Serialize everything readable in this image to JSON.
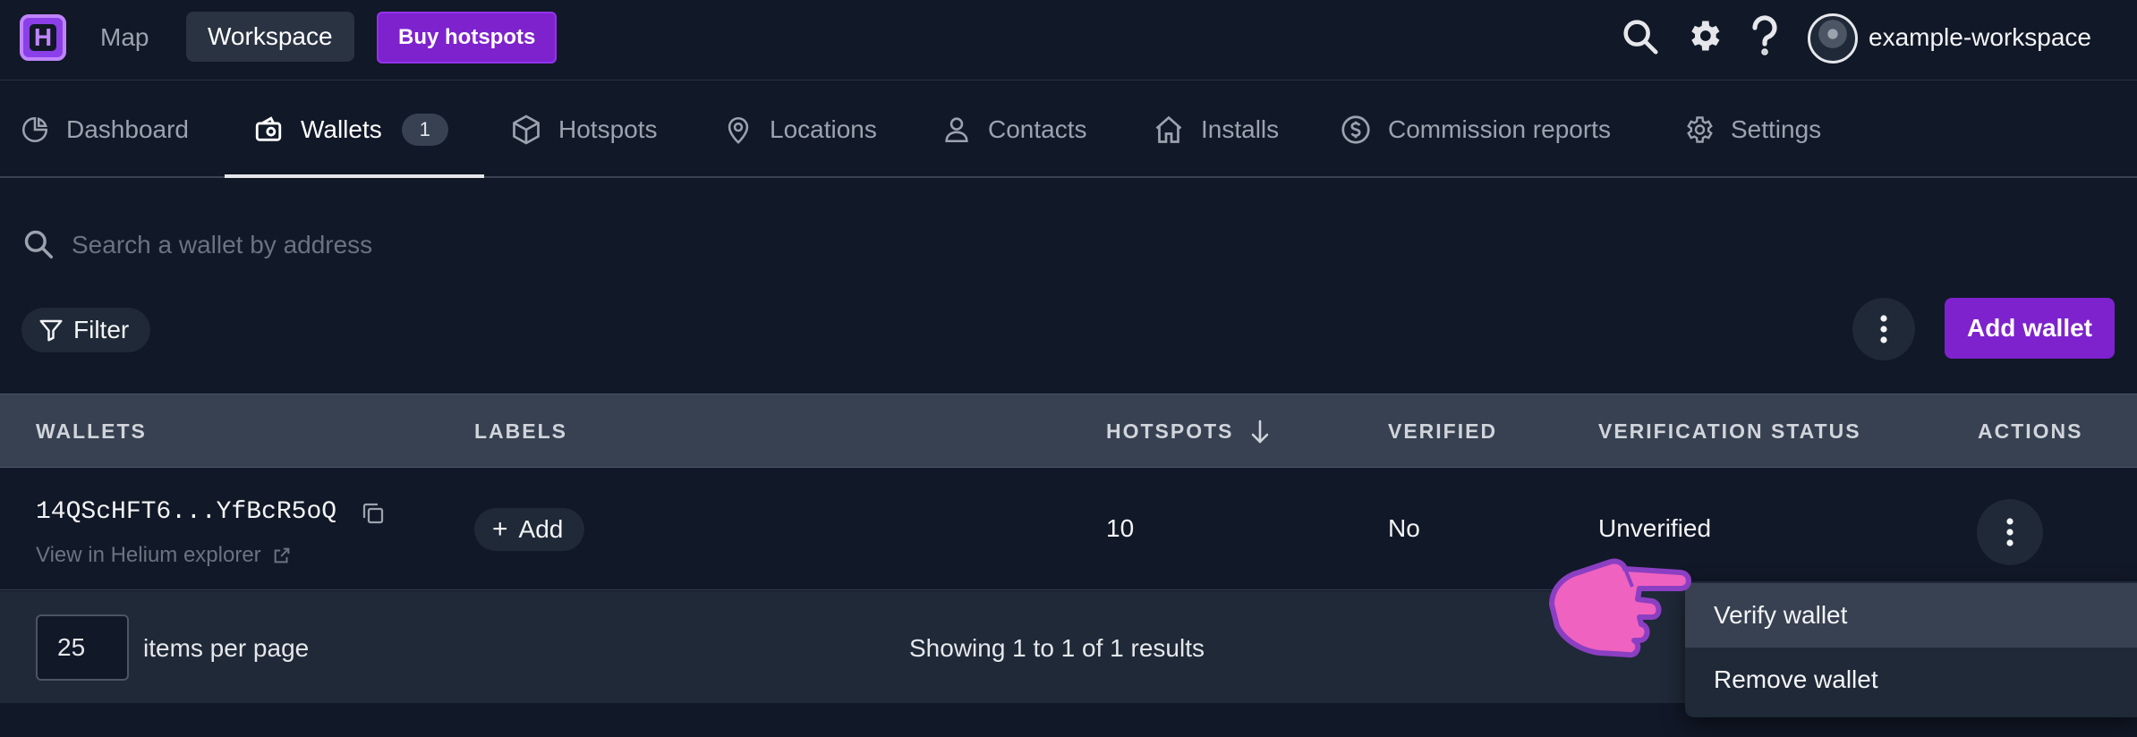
{
  "topbar": {
    "logo_letter": "H",
    "map_label": "Map",
    "workspace_label": "Workspace",
    "buy_label": "Buy hotspots",
    "workspace_name": "example-workspace",
    "icons": [
      "search-icon",
      "gear-icon",
      "help-icon"
    ]
  },
  "tabs": [
    {
      "label": "Dashboard",
      "icon": "pie-chart-icon"
    },
    {
      "label": "Wallets",
      "icon": "wallet-icon",
      "badge": "1",
      "active": true
    },
    {
      "label": "Hotspots",
      "icon": "cube-icon"
    },
    {
      "label": "Locations",
      "icon": "map-pin-icon"
    },
    {
      "label": "Contacts",
      "icon": "user-icon"
    },
    {
      "label": "Installs",
      "icon": "home-icon"
    },
    {
      "label": "Commission reports",
      "icon": "dollar-icon"
    },
    {
      "label": "Settings",
      "icon": "gear-icon"
    }
  ],
  "search": {
    "placeholder": "Search a wallet by address",
    "value": ""
  },
  "toolbar": {
    "filter_label": "Filter",
    "add_wallet_label": "Add wallet"
  },
  "table": {
    "headers": {
      "wallets": "WALLETS",
      "labels": "LABELS",
      "hotspots": "HOTSPOTS",
      "verified": "VERIFIED",
      "verification_status": "VERIFICATION STATUS",
      "actions": "ACTIONS"
    },
    "sort": {
      "column": "hotspots",
      "direction": "descending"
    },
    "rows": [
      {
        "wallet": "14QScHFT6...YfBcR5oQ",
        "explorer_link": "View in Helium explorer",
        "labels_add": "Add",
        "hotspots": "10",
        "verified": "No",
        "verification_status": "Unverified"
      }
    ]
  },
  "pagination": {
    "per_page_value": "25",
    "per_page_label": "items per page",
    "showing": "Showing 1 to 1 of 1 results"
  },
  "row_menu": {
    "items": [
      {
        "label": "Verify wallet",
        "highlighted": true
      },
      {
        "label": "Remove wallet"
      }
    ]
  },
  "colors": {
    "background": "#111827",
    "accent": "#7e22ce",
    "header_bg": "#374151",
    "pointer_hand": "#f062c0"
  }
}
